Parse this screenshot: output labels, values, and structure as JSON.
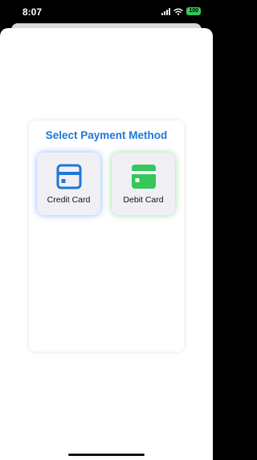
{
  "status_bar": {
    "time": "8:07",
    "battery": "100"
  },
  "panel": {
    "title": "Select Payment Method",
    "options": [
      {
        "label": "Credit Card",
        "icon": "credit-card-icon",
        "color": "#1d77d9"
      },
      {
        "label": "Debit Card",
        "icon": "debit-card-icon",
        "color": "#34c759"
      }
    ]
  },
  "colors": {
    "accent": "#1d77d9",
    "green": "#34c759"
  }
}
